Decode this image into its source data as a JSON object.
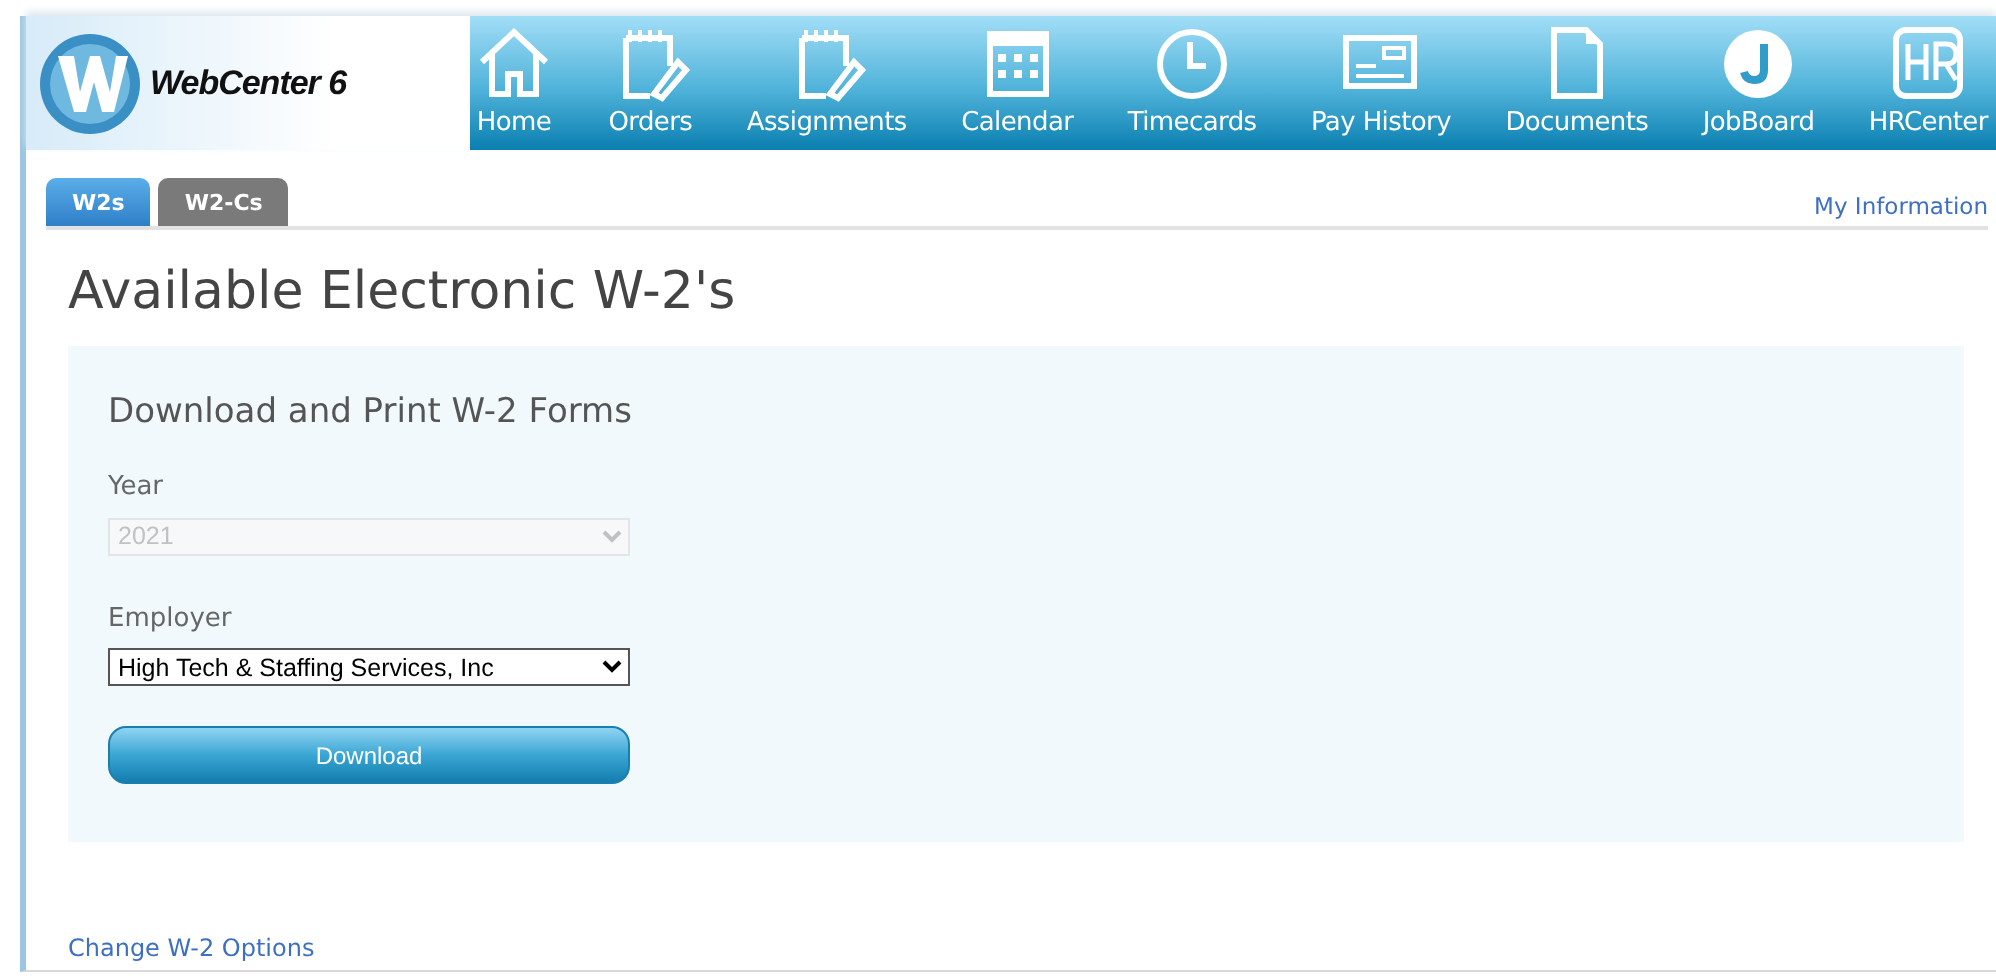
{
  "header": {
    "logo_text": "WebCenter 6",
    "nav": [
      {
        "label": "Home"
      },
      {
        "label": "Orders"
      },
      {
        "label": "Assignments"
      },
      {
        "label": "Calendar"
      },
      {
        "label": "Timecards"
      },
      {
        "label": "Pay History"
      },
      {
        "label": "Documents"
      },
      {
        "label": "JobBoard"
      },
      {
        "label": "HRCenter"
      }
    ]
  },
  "tabs": [
    {
      "label": "W2s",
      "selected": true
    },
    {
      "label": "W2-Cs",
      "selected": false
    }
  ],
  "my_information_link": "My Information",
  "page_title": "Available Electronic W-2's",
  "panel": {
    "heading": "Download and Print W-2 Forms",
    "fields": [
      {
        "label": "Year",
        "value": "2021",
        "disabled": true
      },
      {
        "label": "Employer",
        "value": "High Tech & Staffing Services, Inc",
        "disabled": false
      }
    ],
    "button": "Download"
  },
  "footer_link": "Change W-2 Options"
}
